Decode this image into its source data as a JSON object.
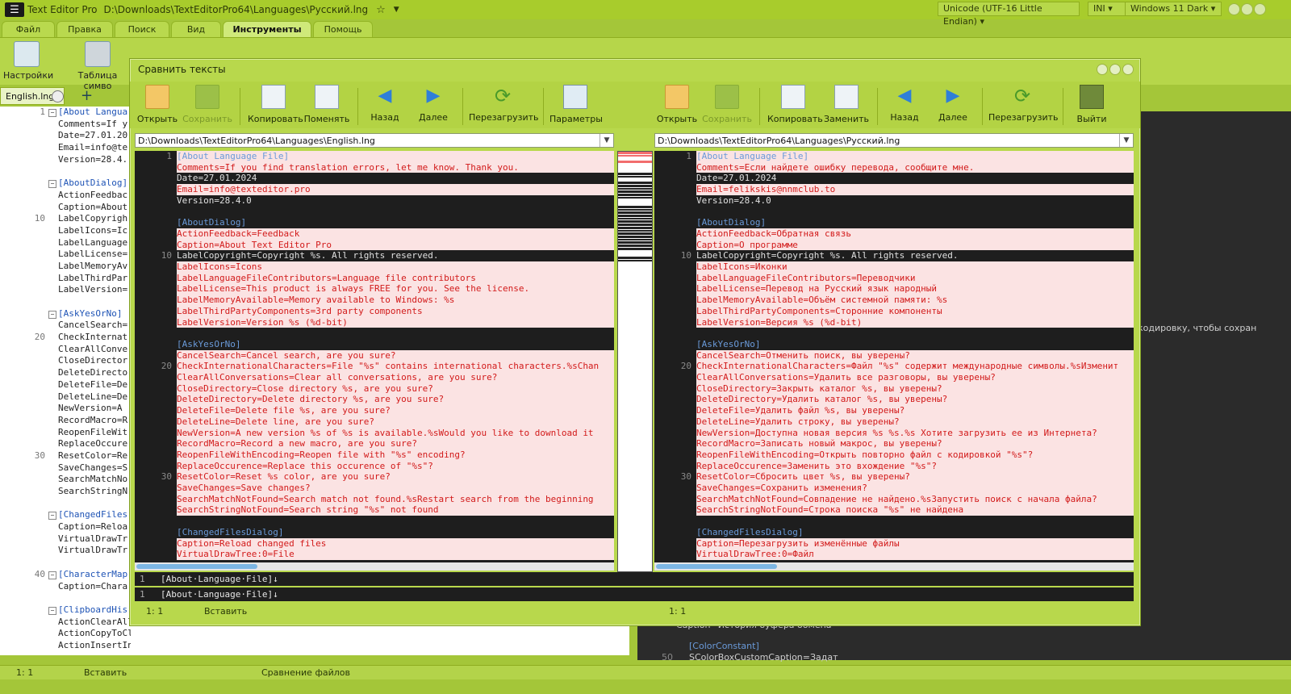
{
  "window": {
    "app_title": "Text Editor Pro",
    "path": "D:\\Downloads\\TextEditorPro64\\Languages\\Русский.lng",
    "encoding": "Unicode (UTF-16 Little Endian)",
    "format": "INI",
    "theme": "Windows 11 Dark"
  },
  "menu": [
    "Файл",
    "Правка",
    "Поиск",
    "Вид",
    "Инструменты",
    "Помощь"
  ],
  "ribbon": {
    "settings": "Настройки",
    "char_table": "Таблица симво"
  },
  "doc_tab": {
    "label": "English.lng"
  },
  "left_editor": [
    {
      "n": "1",
      "t": "[About Langua",
      "s": true,
      "f": "−"
    },
    {
      "n": "",
      "t": "Comments=If y"
    },
    {
      "n": "",
      "t": "Date=27.01.20"
    },
    {
      "n": "",
      "t": "Email=info@te"
    },
    {
      "n": "",
      "t": "Version=28.4."
    },
    {
      "n": "",
      "t": ""
    },
    {
      "n": "",
      "t": "[AboutDialog]",
      "s": true,
      "f": "−"
    },
    {
      "n": "",
      "t": "ActionFeedbac"
    },
    {
      "n": "",
      "t": "Caption=About"
    },
    {
      "n": "10",
      "t": "LabelCopyrigh"
    },
    {
      "n": "",
      "t": "LabelIcons=Ic"
    },
    {
      "n": "",
      "t": "LabelLanguage"
    },
    {
      "n": "",
      "t": "LabelLicense="
    },
    {
      "n": "",
      "t": "LabelMemoryAv"
    },
    {
      "n": "",
      "t": "LabelThirdPar"
    },
    {
      "n": "",
      "t": "LabelVersion="
    },
    {
      "n": "",
      "t": ""
    },
    {
      "n": "",
      "t": "[AskYesOrNo]",
      "s": true,
      "f": "−"
    },
    {
      "n": "",
      "t": "CancelSearch="
    },
    {
      "n": "20",
      "t": "CheckInternat"
    },
    {
      "n": "",
      "t": "ClearAllConve"
    },
    {
      "n": "",
      "t": "CloseDirector"
    },
    {
      "n": "",
      "t": "DeleteDirecto"
    },
    {
      "n": "",
      "t": "DeleteFile=De"
    },
    {
      "n": "",
      "t": "DeleteLine=De"
    },
    {
      "n": "",
      "t": "NewVersion=A "
    },
    {
      "n": "",
      "t": "RecordMacro=R"
    },
    {
      "n": "",
      "t": "ReopenFileWit"
    },
    {
      "n": "",
      "t": "ReplaceOccure"
    },
    {
      "n": "30",
      "t": "ResetColor=Re"
    },
    {
      "n": "",
      "t": "SaveChanges=S"
    },
    {
      "n": "",
      "t": "SearchMatchNo"
    },
    {
      "n": "",
      "t": "SearchStringN"
    },
    {
      "n": "",
      "t": ""
    },
    {
      "n": "",
      "t": "[ChangedFiles",
      "s": true,
      "f": "−"
    },
    {
      "n": "",
      "t": "Caption=Reloa"
    },
    {
      "n": "",
      "t": "VirtualDrawTr"
    },
    {
      "n": "",
      "t": "VirtualDrawTr"
    },
    {
      "n": "",
      "t": ""
    },
    {
      "n": "40",
      "t": "[CharacterMap",
      "s": true,
      "f": "−"
    },
    {
      "n": "",
      "t": "Caption=Chara"
    },
    {
      "n": "",
      "t": ""
    },
    {
      "n": "",
      "t": "[ClipboardHis",
      "s": true,
      "f": "−"
    },
    {
      "n": "",
      "t": "ActionClearAll=Clear all"
    },
    {
      "n": "",
      "t": "ActionCopyToClipboard=Copy to clipboard"
    },
    {
      "n": "",
      "t": "ActionInsertInEditor=Insert into editor"
    }
  ],
  "bg_right": {
    "snippet": "кодировку, чтобы сохран",
    "caption": "Caption=История буфера обмена",
    "color_const": "[ColorConstant]",
    "color_custom": "SColorBoxCustomCaption=Задат",
    "line50": "50"
  },
  "status": {
    "pos": "1: 1",
    "mode": "Вставить",
    "action": "Сравнение файлов"
  },
  "dialog": {
    "title": "Сравнить тексты",
    "left_toolbar": {
      "open": "Открыть",
      "save": "Сохранить",
      "copy": "Копировать",
      "swap": "Поменять",
      "back": "Назад",
      "next": "Далее",
      "reload": "Перезагрузить",
      "params": "Параметры"
    },
    "right_toolbar": {
      "open": "Открыть",
      "save": "Сохранить",
      "copy": "Копировать",
      "replace": "Заменить",
      "back": "Назад",
      "next": "Далее",
      "reload": "Перезагрузить",
      "exit": "Выйти"
    },
    "left_path": "D:\\Downloads\\TextEditorPro64\\Languages\\English.lng",
    "right_path": "D:\\Downloads\\TextEditorPro64\\Languages\\Русский.lng",
    "left_lines": [
      {
        "n": "1",
        "t": "[About Language File]",
        "d": true,
        "s": true
      },
      {
        "n": "",
        "t": "Comments=If you find translation errors, let me know. Thank you.",
        "d": true
      },
      {
        "n": "",
        "t": "Date=27.01.2024",
        "d": false
      },
      {
        "n": "",
        "t": "Email=info@texteditor.pro",
        "d": true
      },
      {
        "n": "",
        "t": "Version=28.4.0",
        "d": false
      },
      {
        "n": "",
        "t": "",
        "d": false
      },
      {
        "n": "",
        "t": "[AboutDialog]",
        "d": false,
        "s": true
      },
      {
        "n": "",
        "t": "ActionFeedback=Feedback",
        "d": true
      },
      {
        "n": "",
        "t": "Caption=About Text Editor Pro",
        "d": true
      },
      {
        "n": "10",
        "t": "LabelCopyright=Copyright %s. All rights reserved.",
        "d": false
      },
      {
        "n": "",
        "t": "LabelIcons=Icons",
        "d": true
      },
      {
        "n": "",
        "t": "LabelLanguageFileContributors=Language file contributors",
        "d": true
      },
      {
        "n": "",
        "t": "LabelLicense=This product is always FREE for you. See the license.",
        "d": true
      },
      {
        "n": "",
        "t": "LabelMemoryAvailable=Memory available to Windows: %s",
        "d": true
      },
      {
        "n": "",
        "t": "LabelThirdPartyComponents=3rd party components",
        "d": true
      },
      {
        "n": "",
        "t": "LabelVersion=Version %s (%d-bit)",
        "d": true
      },
      {
        "n": "",
        "t": "",
        "d": false
      },
      {
        "n": "",
        "t": "[AskYesOrNo]",
        "d": false,
        "s": true
      },
      {
        "n": "",
        "t": "CancelSearch=Cancel search, are you sure?",
        "d": true
      },
      {
        "n": "20",
        "t": "CheckInternationalCharacters=File \"%s\" contains international characters.%sChan",
        "d": true
      },
      {
        "n": "",
        "t": "ClearAllConversations=Clear all conversations, are you sure?",
        "d": true
      },
      {
        "n": "",
        "t": "CloseDirectory=Close directory %s, are you sure?",
        "d": true
      },
      {
        "n": "",
        "t": "DeleteDirectory=Delete directory %s, are you sure?",
        "d": true
      },
      {
        "n": "",
        "t": "DeleteFile=Delete file %s, are you sure?",
        "d": true
      },
      {
        "n": "",
        "t": "DeleteLine=Delete line, are you sure?",
        "d": true
      },
      {
        "n": "",
        "t": "NewVersion=A new version %s of %s is available.%sWould you like to download it",
        "d": true
      },
      {
        "n": "",
        "t": "RecordMacro=Record a new macro, are you sure?",
        "d": true
      },
      {
        "n": "",
        "t": "ReopenFileWithEncoding=Reopen file with \"%s\" encoding?",
        "d": true
      },
      {
        "n": "",
        "t": "ReplaceOccurence=Replace this occurence of \"%s\"?",
        "d": true
      },
      {
        "n": "30",
        "t": "ResetColor=Reset %s color, are you sure?",
        "d": true
      },
      {
        "n": "",
        "t": "SaveChanges=Save changes?",
        "d": true
      },
      {
        "n": "",
        "t": "SearchMatchNotFound=Search match not found.%sRestart search from the beginning",
        "d": true
      },
      {
        "n": "",
        "t": "SearchStringNotFound=Search string \"%s\" not found",
        "d": true
      },
      {
        "n": "",
        "t": "",
        "d": false
      },
      {
        "n": "",
        "t": "[ChangedFilesDialog]",
        "d": false,
        "s": true
      },
      {
        "n": "",
        "t": "Caption=Reload changed files",
        "d": true
      },
      {
        "n": "",
        "t": "VirtualDrawTree:0=File",
        "d": true
      }
    ],
    "right_lines": [
      {
        "n": "1",
        "t": "[About Language File]",
        "d": true,
        "s": true
      },
      {
        "n": "",
        "t": "Comments=Если найдете ошибку перевода, сообщите мне.",
        "d": true
      },
      {
        "n": "",
        "t": "Date=27.01.2024",
        "d": false
      },
      {
        "n": "",
        "t": "Email=felikskis@nnmclub.to",
        "d": true
      },
      {
        "n": "",
        "t": "Version=28.4.0",
        "d": false
      },
      {
        "n": "",
        "t": "",
        "d": false
      },
      {
        "n": "",
        "t": "[AboutDialog]",
        "d": false,
        "s": true
      },
      {
        "n": "",
        "t": "ActionFeedback=Обратная связь",
        "d": true
      },
      {
        "n": "",
        "t": "Caption=О программе",
        "d": true
      },
      {
        "n": "10",
        "t": "LabelCopyright=Copyright %s. All rights reserved.",
        "d": false
      },
      {
        "n": "",
        "t": "LabelIcons=Иконки",
        "d": true
      },
      {
        "n": "",
        "t": "LabelLanguageFileContributors=Переводчики",
        "d": true
      },
      {
        "n": "",
        "t": "LabelLicense=Перевод на Русский язык народный",
        "d": true
      },
      {
        "n": "",
        "t": "LabelMemoryAvailable=Объём системной памяти: %s",
        "d": true
      },
      {
        "n": "",
        "t": "LabelThirdPartyComponents=Сторонние компоненты",
        "d": true
      },
      {
        "n": "",
        "t": "LabelVersion=Версия %s (%d-bit)",
        "d": true
      },
      {
        "n": "",
        "t": "",
        "d": false
      },
      {
        "n": "",
        "t": "[AskYesOrNo]",
        "d": false,
        "s": true
      },
      {
        "n": "",
        "t": "CancelSearch=Отменить поиск, вы уверены?",
        "d": true
      },
      {
        "n": "20",
        "t": "CheckInternationalCharacters=Файл \"%s\" содержит международные символы.%sИзменит",
        "d": true
      },
      {
        "n": "",
        "t": "ClearAllConversations=Удалить все разговоры, вы уверены?",
        "d": true
      },
      {
        "n": "",
        "t": "CloseDirectory=Закрыть каталог %s, вы уверены?",
        "d": true
      },
      {
        "n": "",
        "t": "DeleteDirectory=Удалить каталог %s, вы уверены?",
        "d": true
      },
      {
        "n": "",
        "t": "DeleteFile=Удалить файл %s, вы уверены?",
        "d": true
      },
      {
        "n": "",
        "t": "DeleteLine=Удалить строку, вы уверены?",
        "d": true
      },
      {
        "n": "",
        "t": "NewVersion=Доступна новая версия %s %s.%s Хотите загрузить ее из Интернета?",
        "d": true
      },
      {
        "n": "",
        "t": "RecordMacro=Записать новый макрос, вы уверены?",
        "d": true
      },
      {
        "n": "",
        "t": "ReopenFileWithEncoding=Открыть повторно файл с кодировкой \"%s\"?",
        "d": true
      },
      {
        "n": "",
        "t": "ReplaceOccurence=Заменить это вхождение \"%s\"?",
        "d": true
      },
      {
        "n": "30",
        "t": "ResetColor=Сбросить цвет %s, вы уверены?",
        "d": true
      },
      {
        "n": "",
        "t": "SaveChanges=Сохранить изменения?",
        "d": true
      },
      {
        "n": "",
        "t": "SearchMatchNotFound=Совпадение не найдено.%sЗапустить поиск с начала файла?",
        "d": true
      },
      {
        "n": "",
        "t": "SearchStringNotFound=Строка поиска \"%s\" не найдена",
        "d": true
      },
      {
        "n": "",
        "t": "",
        "d": false
      },
      {
        "n": "",
        "t": "[ChangedFilesDialog]",
        "d": false,
        "s": true
      },
      {
        "n": "",
        "t": "Caption=Перезагрузить изменённые файлы",
        "d": true
      },
      {
        "n": "",
        "t": "VirtualDrawTree:0=Файл",
        "d": true
      }
    ],
    "detail": {
      "n": "1",
      "left": "[About·Language·File]↓",
      "right": "[About·Language·File]↓"
    },
    "status_left": {
      "pos": "1: 1",
      "mode": "Вставить"
    },
    "status_right": {
      "pos": "1: 1"
    }
  }
}
